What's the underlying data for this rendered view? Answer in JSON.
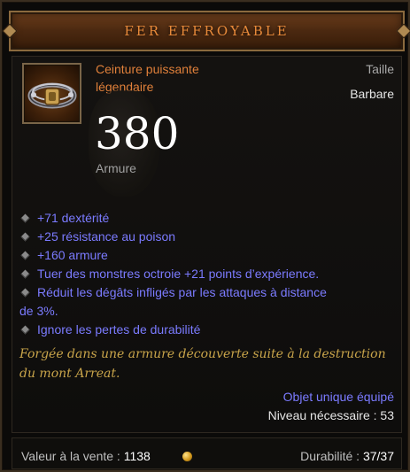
{
  "title": "FER EFFROYABLE",
  "item": {
    "type_line1": "Ceinture puissante",
    "type_line2": "légendaire",
    "slot": "Taille",
    "class": "Barbare",
    "icon": "belt-icon"
  },
  "stats": {
    "armor_value": "380",
    "armor_label": "Armure"
  },
  "affixes": [
    "+71 dextérité",
    "+25 résistance au poison",
    "+160 armure",
    "Tuer des monstres octroie +21 points d’expérience.",
    "Réduit les dégâts infligés par les attaques à distance",
    "Ignore les pertes de durabilité"
  ],
  "affix_wrap": "de 3%.",
  "flavor_text": "Forgée dans une armure découverte suite à la destruction du mont Arreat.",
  "unique_equipped": "Objet unique équipé",
  "level_required": "Niveau nécessaire : 53",
  "footer": {
    "sell_label": "Valeur à la vente : ",
    "sell_value": "1138",
    "durability_label": "Durabilité : ",
    "durability_value": "37/37"
  },
  "colors": {
    "legendary": "#e0803a",
    "magic_affix": "#7b7bff",
    "flavor": "#c8a44a"
  }
}
